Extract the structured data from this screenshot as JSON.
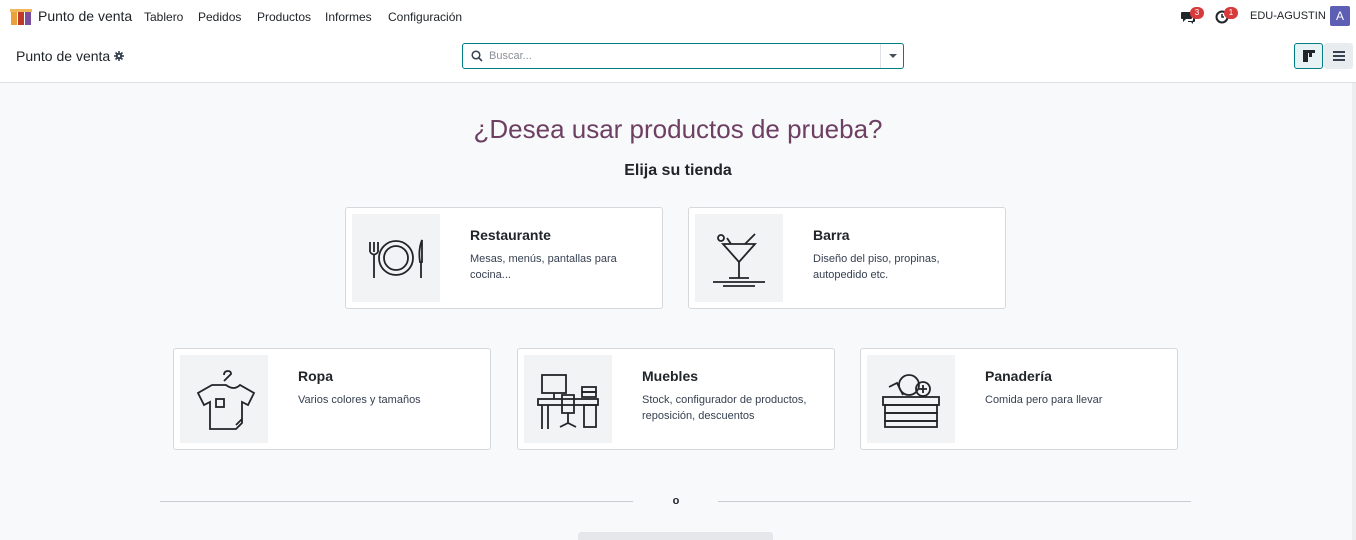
{
  "app": {
    "name": "Punto de venta",
    "menu": [
      "Tablero",
      "Pedidos",
      "Productos",
      "Informes",
      "Configuración"
    ]
  },
  "systray": {
    "messages_count": "3",
    "activities_count": "1",
    "company": "EDU-AGUSTIN",
    "avatar_letter": "A"
  },
  "control_panel": {
    "breadcrumb": "Punto de venta",
    "search_placeholder": "Buscar..."
  },
  "main": {
    "headline": "¿Desea usar productos de prueba?",
    "subheadline": "Elija su tienda",
    "cards": [
      {
        "title": "Restaurante",
        "description": "Mesas, menús, pantallas para cocina...",
        "icon": "plate-cutlery-icon"
      },
      {
        "title": "Barra",
        "description": "Diseño del piso, propinas, autopedido etc.",
        "icon": "cocktail-icon"
      },
      {
        "title": "Ropa",
        "description": "Varios colores y tamaños",
        "icon": "tshirt-icon"
      },
      {
        "title": "Muebles",
        "description": "Stock, configurador de productos, reposición, descuentos",
        "icon": "desk-chair-icon"
      },
      {
        "title": "Panadería",
        "description": "Comida pero para llevar",
        "icon": "bread-basket-icon"
      }
    ],
    "separator": "o"
  },
  "colors": {
    "headline": "#6d3f63",
    "accent": "#017e84",
    "badge": "#d63a3a",
    "avatar": "#5c5fb3"
  }
}
